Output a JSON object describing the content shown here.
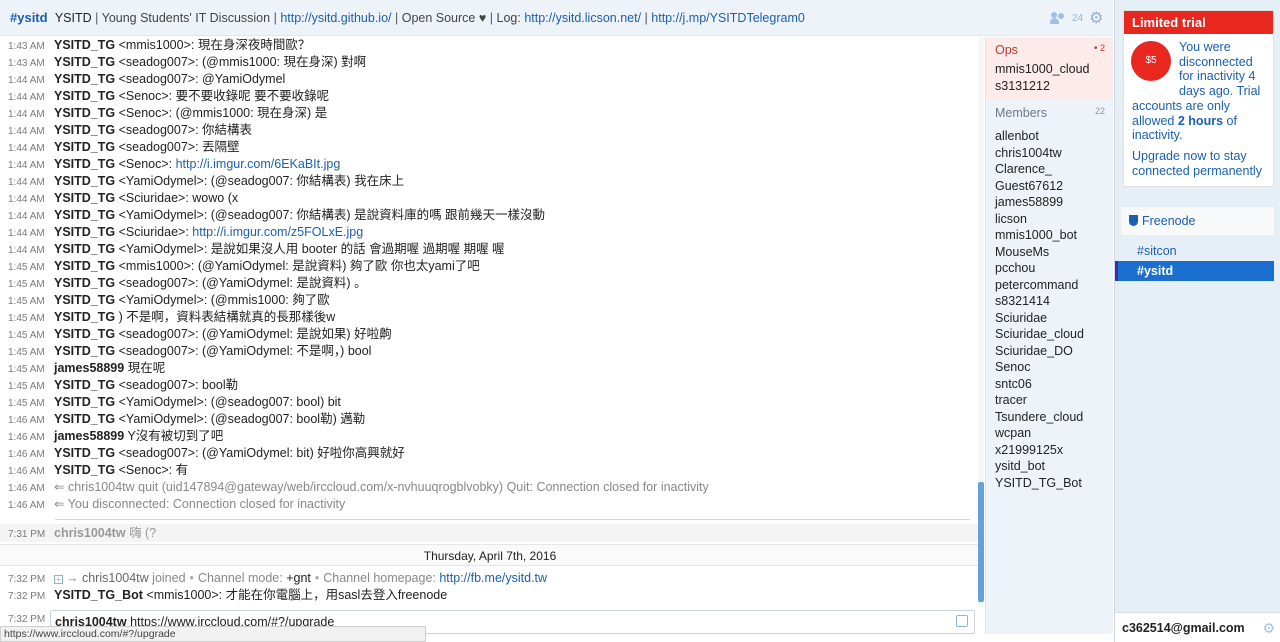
{
  "header": {
    "channel": "#ysitd",
    "topic_name": "YSITD",
    "topic_desc": "Young Students' IT Discussion",
    "link_github": "http://ysitd.github.io/",
    "open_source": "Open Source ♥",
    "log_label": "Log:",
    "link_log": "http://ysitd.licson.net/",
    "link_telegram": "http://j.mp/YSITDTelegram0",
    "user_count": "24"
  },
  "messages": [
    {
      "ts": "1:43 AM",
      "nick": "YSITD_TG",
      "text": "<mmis1000>: 現在身深夜時間歐？"
    },
    {
      "ts": "1:43 AM",
      "nick": "YSITD_TG",
      "text": "<seadog007>: (@mmis1000: 現在身深) 對啊"
    },
    {
      "ts": "1:44 AM",
      "nick": "YSITD_TG",
      "text": "<seadog007>: @YamiOdymel"
    },
    {
      "ts": "1:44 AM",
      "nick": "YSITD_TG",
      "text": "<Senoc>: 要不要收錄呢 要不要收錄呢"
    },
    {
      "ts": "1:44 AM",
      "nick": "YSITD_TG",
      "text": "<Senoc>: (@mmis1000: 現在身深) 是"
    },
    {
      "ts": "1:44 AM",
      "nick": "YSITD_TG",
      "text": "<seadog007>: 你結構表"
    },
    {
      "ts": "1:44 AM",
      "nick": "YSITD_TG",
      "text": "<seadog007>: 丟隔壁"
    },
    {
      "ts": "1:44 AM",
      "nick": "YSITD_TG",
      "text": "<Senoc>: ",
      "link": "http://i.imgur.com/6EKaBIt.jpg"
    },
    {
      "ts": "1:44 AM",
      "nick": "YSITD_TG",
      "text": "<YamiOdymel>: (@seadog007: 你結構表) 我在床上"
    },
    {
      "ts": "1:44 AM",
      "nick": "YSITD_TG",
      "text": "<Sciuridae>: wowo (x"
    },
    {
      "ts": "1:44 AM",
      "nick": "YSITD_TG",
      "text": "<YamiOdymel>: (@seadog007: 你結構表) 是說資料庫的嗎 跟前幾天一樣沒動"
    },
    {
      "ts": "1:44 AM",
      "nick": "YSITD_TG",
      "text": "<Sciuridae>: ",
      "link": "http://i.imgur.com/z5FOLxE.jpg"
    },
    {
      "ts": "1:44 AM",
      "nick": "YSITD_TG",
      "text": "<YamiOdymel>: 是說如果沒人用 booter 的話 會過期喔 過期喔 期喔 喔"
    },
    {
      "ts": "1:45 AM",
      "nick": "YSITD_TG",
      "text": "<mmis1000>: (@YamiOdymel: 是說資料) 夠了歐 你也太yami了吧"
    },
    {
      "ts": "1:45 AM",
      "nick": "YSITD_TG",
      "text": "<seadog007>: (@YamiOdymel: 是說資料) 。"
    },
    {
      "ts": "1:45 AM",
      "nick": "YSITD_TG",
      "text": "<YamiOdymel>: (@mmis1000: 夠了歐"
    },
    {
      "ts": "1:45 AM",
      "nick": "YSITD_TG",
      "text": ") 不是啊，資料表結構就真的長那樣後w"
    },
    {
      "ts": "1:45 AM",
      "nick": "YSITD_TG",
      "text": "<seadog007>: (@YamiOdymel: 是說如果) 好啦齁"
    },
    {
      "ts": "1:45 AM",
      "nick": "YSITD_TG",
      "text": "<seadog007>: (@YamiOdymel: 不是啊，) bool"
    },
    {
      "ts": "1:45 AM",
      "nick": "james58899",
      "text": "現在呢"
    },
    {
      "ts": "1:45 AM",
      "nick": "YSITD_TG",
      "text": "<seadog007>: bool勒"
    },
    {
      "ts": "1:45 AM",
      "nick": "YSITD_TG",
      "text": "<YamiOdymel>: (@seadog007: bool) bit"
    },
    {
      "ts": "1:46 AM",
      "nick": "YSITD_TG",
      "text": "<YamiOdymel>: (@seadog007: bool勒) 邁勒"
    },
    {
      "ts": "1:46 AM",
      "nick": "james58899",
      "text": "Y沒有被切到了吧"
    },
    {
      "ts": "1:46 AM",
      "nick": "YSITD_TG",
      "text": "<seadog007>: (@YamiOdymel: bit) 好啦你高興就好"
    },
    {
      "ts": "1:46 AM",
      "nick": "YSITD_TG",
      "text": "<Senoc>: 有"
    }
  ],
  "sys_messages": [
    {
      "ts": "1:46 AM",
      "text": "chris1004tw quit (uid147894@gateway/web/irccloud.com/x-nvhuuqrogblvobky) Quit: Connection closed for inactivity"
    },
    {
      "ts": "1:46 AM",
      "text": "You disconnected: Connection closed for inactivity"
    }
  ],
  "grey_row": {
    "ts": "7:31 PM",
    "nick": "chris1004tw",
    "text": "嗨 (?"
  },
  "date_separator": "Thursday, April 7th, 2016",
  "join_row": {
    "ts": "7:32 PM",
    "nick": "chris1004tw",
    "joined": "joined",
    "mode_label": "Channel mode:",
    "mode": "+gnt",
    "homepage_label": "Channel homepage:",
    "homepage": "http://fb.me/ysitd.tw"
  },
  "last_row": {
    "ts": "7:32 PM",
    "nick": "YSITD_TG_Bot",
    "text": "<mmis1000>: 才能在你電腦上，用sasl去登入freenode"
  },
  "input": {
    "ts": "7:32 PM",
    "nick": "chris1004tw",
    "value": "https://www.irccloud.com/#?/upgrade"
  },
  "statusbar": "https://www.irccloud.com/#?/upgrade",
  "ops": {
    "title": "Ops",
    "count": "2",
    "items": [
      "mmis1000_cloud",
      "s3131212"
    ]
  },
  "members": {
    "title": "Members",
    "count": "22",
    "items": [
      "allenbot",
      "chris1004tw",
      "Clarence_",
      "Guest67612",
      "james58899",
      "licson",
      "mmis1000_bot",
      "MouseMs",
      "pcchou",
      "petercommand",
      "s8321414",
      "Sciuridae",
      "Sciuridae_cloud",
      "Sciuridae_DO",
      "Senoc",
      "sntc06",
      "tracer",
      "Tsundere_cloud",
      "wcpan",
      "x21999125x",
      "ysitd_bot",
      "YSITD_TG_Bot"
    ]
  },
  "trial": {
    "title": "Limited trial",
    "price": "$5",
    "text1": "You were disconnected for inactivity 4 days ago. Trial accounts are only allowed ",
    "bold": "2 hours",
    "text2": " of inactivity.",
    "upgrade": "Upgrade now to stay connected permanently"
  },
  "network": {
    "name": "Freenode",
    "channels": [
      "#sitcon",
      "#ysitd"
    ]
  },
  "account": "c362514@gmail.com"
}
